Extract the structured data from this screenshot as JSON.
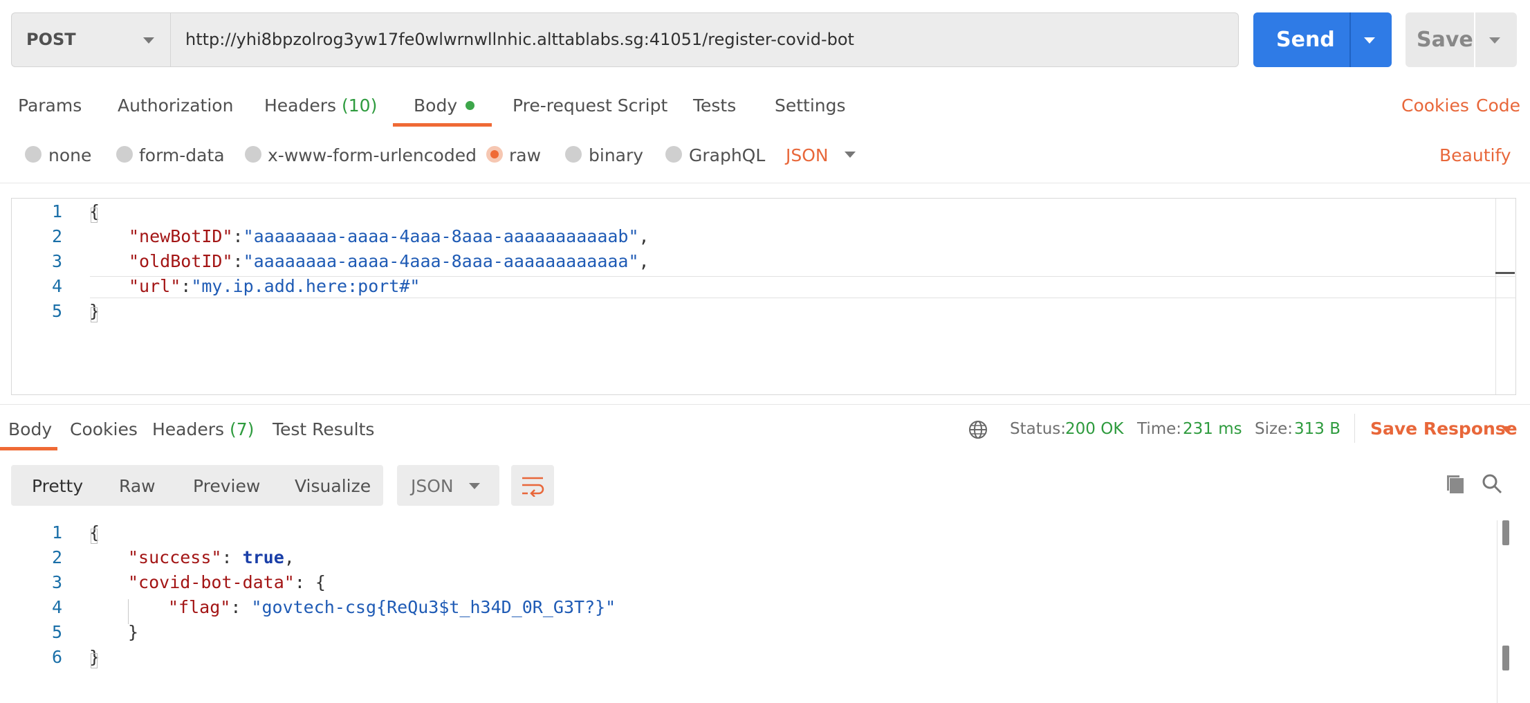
{
  "request": {
    "method": "POST",
    "url": "http://yhi8bpzolrog3yw17fe0wlwrnwllnhic.alttablabs.sg:41051/register-covid-bot",
    "send_label": "Send",
    "save_label": "Save"
  },
  "request_tabs": [
    {
      "label": "Params"
    },
    {
      "label": "Authorization"
    },
    {
      "label": "Headers",
      "count": "(10)"
    },
    {
      "label": "Body"
    },
    {
      "label": "Pre-request Script"
    },
    {
      "label": "Tests"
    },
    {
      "label": "Settings"
    }
  ],
  "links": {
    "cookies": "Cookies",
    "code": "Code",
    "beautify": "Beautify"
  },
  "body_types": [
    {
      "label": "none"
    },
    {
      "label": "form-data"
    },
    {
      "label": "x-www-form-urlencoded"
    },
    {
      "label": "raw",
      "selected": true
    },
    {
      "label": "binary"
    },
    {
      "label": "GraphQL"
    }
  ],
  "body_format": "JSON",
  "request_body": {
    "line_numbers": [
      "1",
      "2",
      "3",
      "4",
      "5"
    ],
    "open": "{",
    "close": "}",
    "k1": "\"newBotID\"",
    "v1": "\"aaaaaaaa-aaaa-4aaa-8aaa-aaaaaaaaaaab\"",
    "k2": "\"oldBotID\"",
    "v2": "\"aaaaaaaa-aaaa-4aaa-8aaa-aaaaaaaaaaaa\"",
    "k3": "\"url\"",
    "v3": "\"my.ip.add.here:port#\""
  },
  "response_tabs": [
    {
      "label": "Body"
    },
    {
      "label": "Cookies"
    },
    {
      "label": "Headers",
      "count": "(7)"
    },
    {
      "label": "Test Results"
    }
  ],
  "response_meta": {
    "status_label": "Status:",
    "status_value": "200 OK",
    "time_label": "Time:",
    "time_value": "231 ms",
    "size_label": "Size:",
    "size_value": "313 B",
    "save_response": "Save Response"
  },
  "response_formats": [
    "Pretty",
    "Raw",
    "Preview",
    "Visualize"
  ],
  "response_format_type": "JSON",
  "response_body": {
    "line_numbers": [
      "1",
      "2",
      "3",
      "4",
      "5",
      "6"
    ],
    "open": "{",
    "k1": "\"success\"",
    "v1": "true",
    "k2": "\"covid-bot-data\"",
    "k3": "\"flag\"",
    "v3": "\"govtech-csg{ReQu3$t_h34D_0R_G3T?}\"",
    "inner_close": "}",
    "close": "}"
  },
  "icons": [
    "caret-down-icon",
    "globe-icon",
    "wrap-lines-icon",
    "copy-icon",
    "search-icon"
  ],
  "colors": {
    "accent": "#ef6a35",
    "send_blue": "#2f7be6",
    "success_green": "#2e9b3e"
  }
}
